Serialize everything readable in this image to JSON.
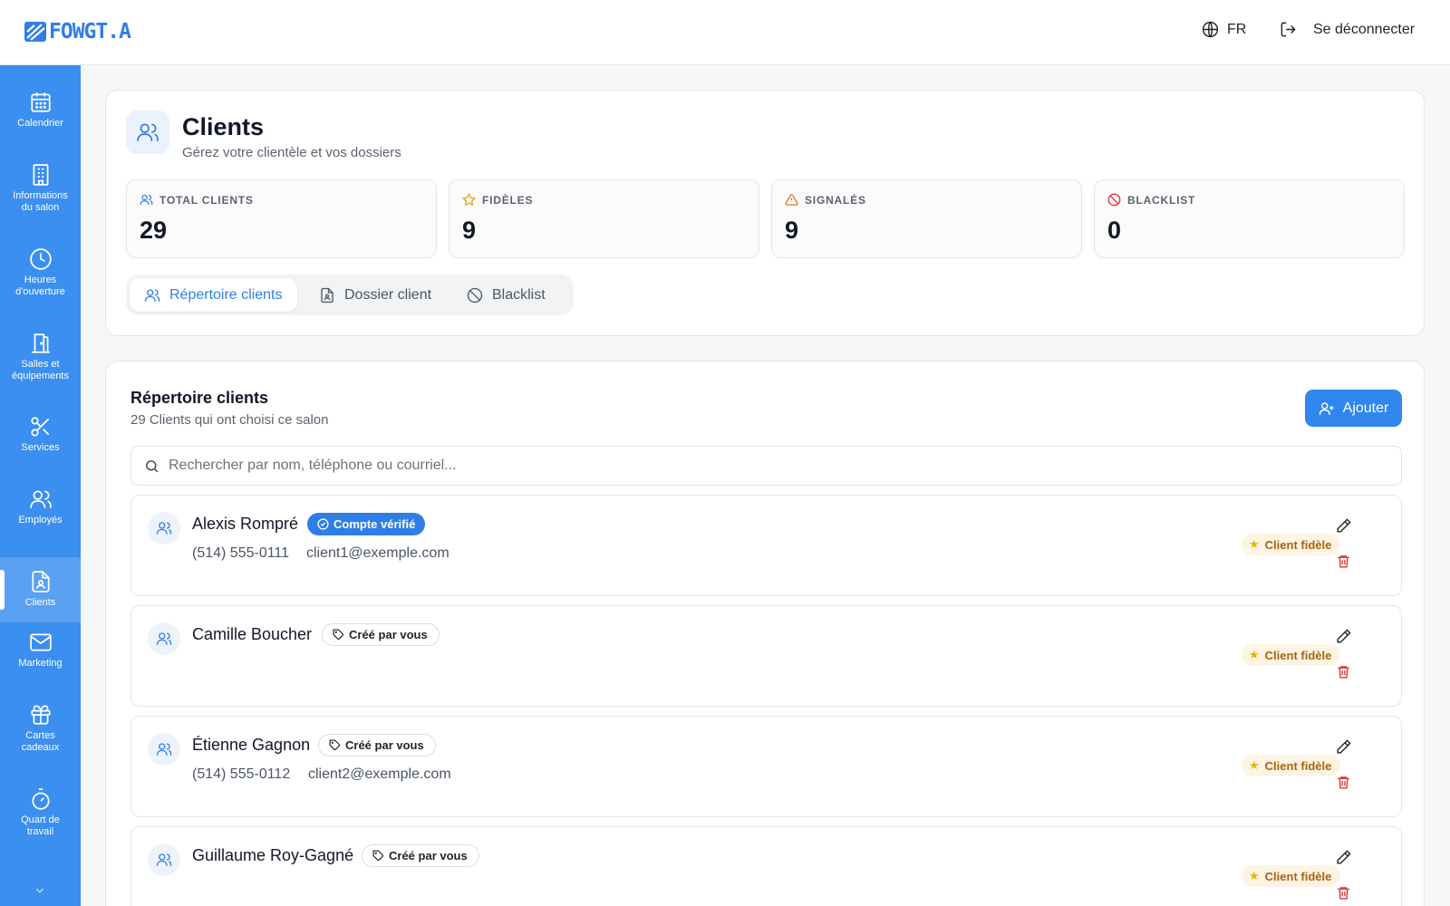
{
  "brand": {
    "logo_text": "FOWGT.A"
  },
  "topbar": {
    "language": "FR",
    "logout_label": "Se déconnecter"
  },
  "sidebar": {
    "items": [
      {
        "label": "Calendrier",
        "icon": "calendar-icon"
      },
      {
        "label": "Informations du salon",
        "icon": "building-icon"
      },
      {
        "label": "Heures d'ouverture",
        "icon": "clock-icon"
      },
      {
        "label": "Salles et équipements",
        "icon": "door-icon"
      },
      {
        "label": "Services",
        "icon": "scissors-icon"
      },
      {
        "label": "Employés",
        "icon": "users-icon"
      },
      {
        "label": "Clients",
        "icon": "contact-file-icon",
        "active": true
      },
      {
        "label": "Marketing",
        "icon": "mail-icon"
      },
      {
        "label": "Cartes cadeaux",
        "icon": "gift-icon"
      },
      {
        "label": "Quart de travail",
        "icon": "timer-icon"
      }
    ]
  },
  "page": {
    "title": "Clients",
    "subtitle": "Gérez votre clientèle et vos dossiers"
  },
  "stats": [
    {
      "label": "TOTAL CLIENTS",
      "value": "29",
      "icon": "users-icon",
      "color": "#2f7ee6"
    },
    {
      "label": "FIDÈLES",
      "value": "9",
      "icon": "star-icon",
      "color": "#e3a008"
    },
    {
      "label": "SIGNALÉS",
      "value": "9",
      "icon": "warning-icon",
      "color": "#e8730c"
    },
    {
      "label": "BLACKLIST",
      "value": "0",
      "icon": "ban-icon",
      "color": "#e02424"
    }
  ],
  "tabs": [
    {
      "label": "Répertoire clients",
      "active": true
    },
    {
      "label": "Dossier client"
    },
    {
      "label": "Blacklist"
    }
  ],
  "directory": {
    "title": "Répertoire clients",
    "subtitle": "29 Clients qui ont choisi ce salon",
    "add_label": "Ajouter",
    "search_placeholder": "Rechercher par nom, téléphone ou courriel...",
    "clients": [
      {
        "name": "Alexis Rompré",
        "badge": "Compte vérifié",
        "badge_type": "verified",
        "phone": "(514) 555-0111",
        "email": "client1@exemple.com",
        "status": "Client fidèle"
      },
      {
        "name": "Camille Boucher",
        "badge": "Créé par vous",
        "badge_type": "created",
        "phone": "",
        "email": "",
        "status": "Client fidèle"
      },
      {
        "name": "Étienne Gagnon",
        "badge": "Créé par vous",
        "badge_type": "created",
        "phone": "(514) 555-0112",
        "email": "client2@exemple.com",
        "status": "Client fidèle"
      },
      {
        "name": "Guillaume Roy-Gagné",
        "badge": "Créé par vous",
        "badge_type": "created",
        "phone": "",
        "email": "",
        "status": "Client fidèle"
      }
    ]
  },
  "colors": {
    "accent": "#2f7ee6",
    "sidebar": "#3b8ff0",
    "danger": "#e02424",
    "loyal_bg": "#fdf4e3"
  }
}
